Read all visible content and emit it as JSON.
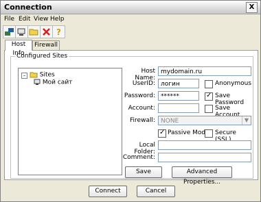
{
  "window": {
    "title": "Connection",
    "close_symbol": "X"
  },
  "menu": {
    "items": [
      "File",
      "Edit",
      "View",
      "Help"
    ]
  },
  "tabs": {
    "items": [
      "Host Info",
      "Firewall"
    ],
    "active": "Host Info"
  },
  "group": {
    "title": "Configured Sites"
  },
  "tree": {
    "root": "Sites",
    "child": "Мой сайт"
  },
  "form": {
    "host_name": {
      "label": "Host Name:",
      "value": "mydomain.ru"
    },
    "userid": {
      "label": "UserID:",
      "value": "логин"
    },
    "password": {
      "label": "Password:",
      "value": "******"
    },
    "account": {
      "label": "Account:",
      "value": ""
    },
    "firewall": {
      "label": "Firewall:",
      "value": "NONE"
    },
    "local_folder": {
      "label": "Local Folder:",
      "value": ""
    },
    "comment": {
      "label": "Comment:",
      "value": ""
    },
    "anonymous": {
      "label": "Anonymous",
      "checked": false
    },
    "save_password": {
      "label": "Save Password",
      "checked": true
    },
    "save_account": {
      "label": "Save Account",
      "checked": false
    },
    "passive_mode": {
      "label": "Passive Mode",
      "checked": true
    },
    "secure_ssl": {
      "label": "Secure (SSL)",
      "checked": false
    }
  },
  "buttons": {
    "save": "Save",
    "advanced": "Advanced Properties...",
    "connect": "Connect",
    "cancel": "Cancel"
  }
}
